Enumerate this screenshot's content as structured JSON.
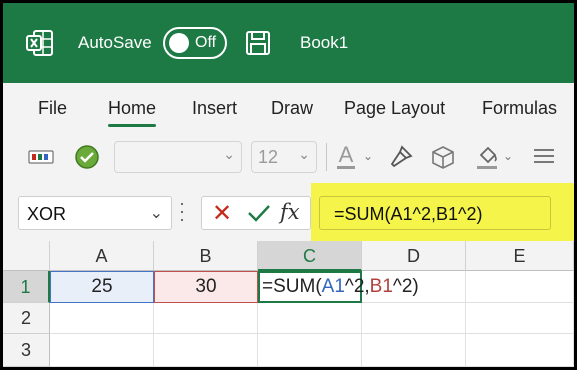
{
  "titlebar": {
    "autosave_label": "AutoSave",
    "toggle_state": "Off",
    "book_title": "Book1",
    "logo_icon": "excel-logo-icon",
    "save_icon": "save-icon",
    "background": "#1e7a45"
  },
  "ribbon": {
    "tabs": [
      "File",
      "Home",
      "Insert",
      "Draw",
      "Page Layout",
      "Formulas"
    ],
    "active_tab": "Home",
    "font_name": "",
    "font_size": "12",
    "font_color_glyph": "A"
  },
  "formula_bar": {
    "name_box": "XOR",
    "cancel_glyph": "✕",
    "enter_icon": "check-icon",
    "fx_label": "fx",
    "formula": "=SUM(A1^2,B1^2)",
    "highlight_color": "#f5f44a"
  },
  "grid": {
    "columns": [
      "A",
      "B",
      "C",
      "D",
      "E"
    ],
    "rows": [
      "1",
      "2",
      "3"
    ],
    "a1": "25",
    "b1": "30",
    "c1_prefix": "=SUM(",
    "c1_ref_a": "A1",
    "c1_mid": "^2,",
    "c1_ref_b": "B1",
    "c1_suffix": "^2)"
  }
}
